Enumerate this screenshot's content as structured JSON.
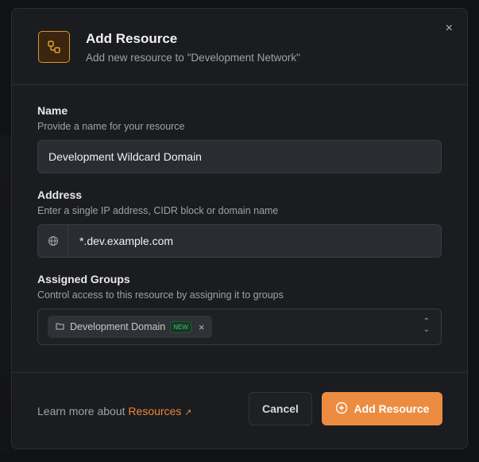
{
  "dialog": {
    "title": "Add Resource",
    "subtitle": "Add new resource to \"Development Network\"",
    "close": "×"
  },
  "name": {
    "label": "Name",
    "help": "Provide a name for your resource",
    "value": "Development Wildcard Domain"
  },
  "address": {
    "label": "Address",
    "help": "Enter a single IP address, CIDR block or domain name",
    "value": "*.dev.example.com"
  },
  "groups": {
    "label": "Assigned Groups",
    "help": "Control access to this resource by assigning it to groups",
    "chips": [
      {
        "label": "Development Domain",
        "badge": "NEW"
      }
    ]
  },
  "footer": {
    "learn_prefix": "Learn more about",
    "learn_link": "Resources",
    "cancel": "Cancel",
    "submit": "Add Resource"
  }
}
